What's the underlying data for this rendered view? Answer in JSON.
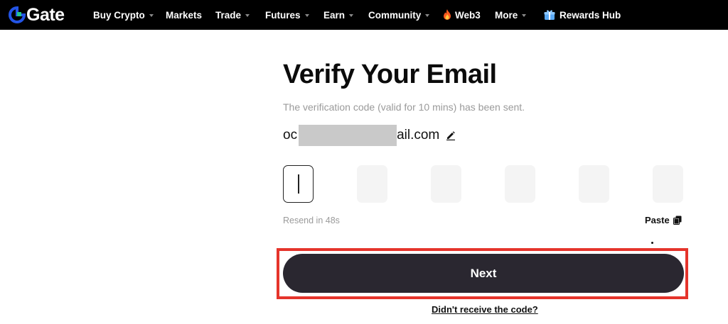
{
  "nav": {
    "logo_text": "Gate",
    "items": [
      {
        "label": "Buy Crypto",
        "has_caret": true
      },
      {
        "label": "Markets",
        "has_caret": false
      },
      {
        "label": "Trade",
        "has_caret": true
      },
      {
        "label": "Futures",
        "has_caret": true
      },
      {
        "label": "Earn",
        "has_caret": true
      },
      {
        "label": "Community",
        "has_caret": true
      },
      {
        "label": "Web3",
        "icon": "fire-icon"
      },
      {
        "label": "More",
        "has_caret": true
      },
      {
        "label": "Rewards Hub",
        "icon": "gift-icon"
      }
    ]
  },
  "verify": {
    "title": "Verify Your Email",
    "subtitle": "The verification code (valid for 10 mins) has been sent.",
    "email_prefix": "oc",
    "email_suffix": "ail.com",
    "code_digits": [
      "",
      "",
      "",
      "",
      "",
      ""
    ],
    "resend_text": "Resend in 48s",
    "paste_label": "Paste",
    "next_label": "Next",
    "no_code_link": "Didn't receive the code?"
  },
  "colors": {
    "nav_bg": "#000000",
    "logo_blue": "#2354e6",
    "button_bg": "#2a2730",
    "highlight_red": "#e5342b",
    "muted_text": "#9a9a9a"
  }
}
